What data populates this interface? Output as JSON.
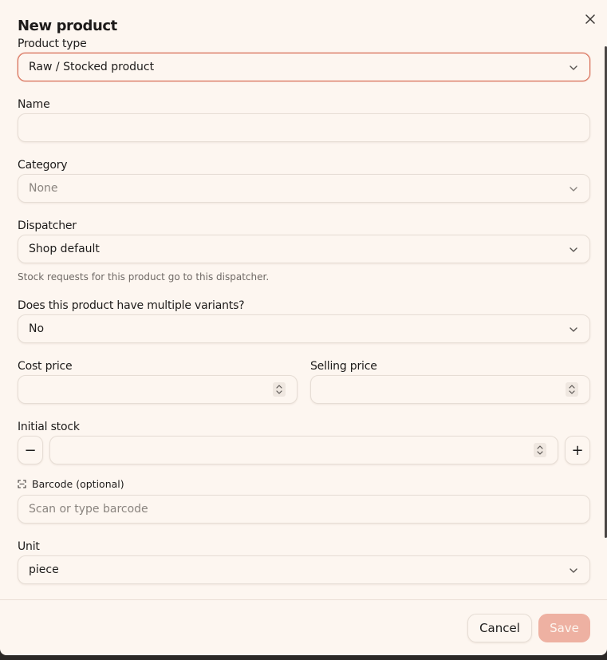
{
  "dialog": {
    "title": "New product",
    "close_icon": "close-icon",
    "accent_color": "#d76a52"
  },
  "fields": {
    "product_type": {
      "label": "Product type",
      "value": "Raw / Stocked product"
    },
    "name": {
      "label": "Name",
      "value": ""
    },
    "category": {
      "label": "Category",
      "value": "None"
    },
    "dispatcher": {
      "label": "Dispatcher",
      "value": "Shop default",
      "hint": "Stock requests for this product go to this dispatcher."
    },
    "variants": {
      "label": "Does this product have multiple variants?",
      "value": "No"
    },
    "cost_price": {
      "label": "Cost price",
      "value": ""
    },
    "selling_price": {
      "label": "Selling price",
      "value": ""
    },
    "initial_stock": {
      "label": "Initial stock",
      "value": "",
      "decrement": "−",
      "increment": "+"
    },
    "barcode": {
      "label": "Barcode (optional)",
      "placeholder": "Scan or type barcode",
      "icon": "scan-icon"
    },
    "unit": {
      "label": "Unit",
      "value": "piece"
    }
  },
  "footer": {
    "cancel_label": "Cancel",
    "save_label": "Save"
  }
}
